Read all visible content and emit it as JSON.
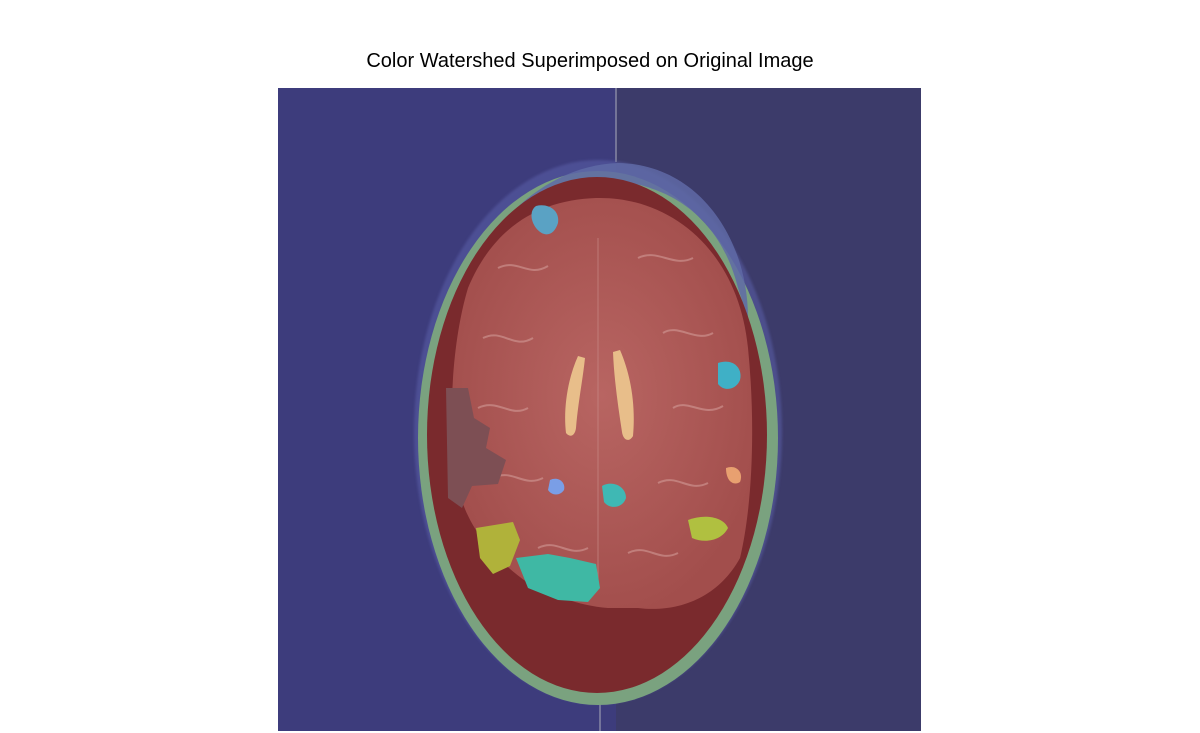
{
  "figure": {
    "title": "Color Watershed Superimposed on Original Image"
  },
  "image": {
    "subject": "axial-brain-mri-watershed-overlay",
    "colors": {
      "background_left": "#3d3c7c",
      "background_right": "#3c3b6a",
      "brain": "#b05a57",
      "skull_band": "#7a2a2d",
      "scalp": "#7aa27f",
      "ventricles": "#e8be8a",
      "teal": "#3fb8a4",
      "olive": "#b0b23a",
      "mauve": "#7d4f54",
      "sky": "#5aa2c4"
    }
  }
}
